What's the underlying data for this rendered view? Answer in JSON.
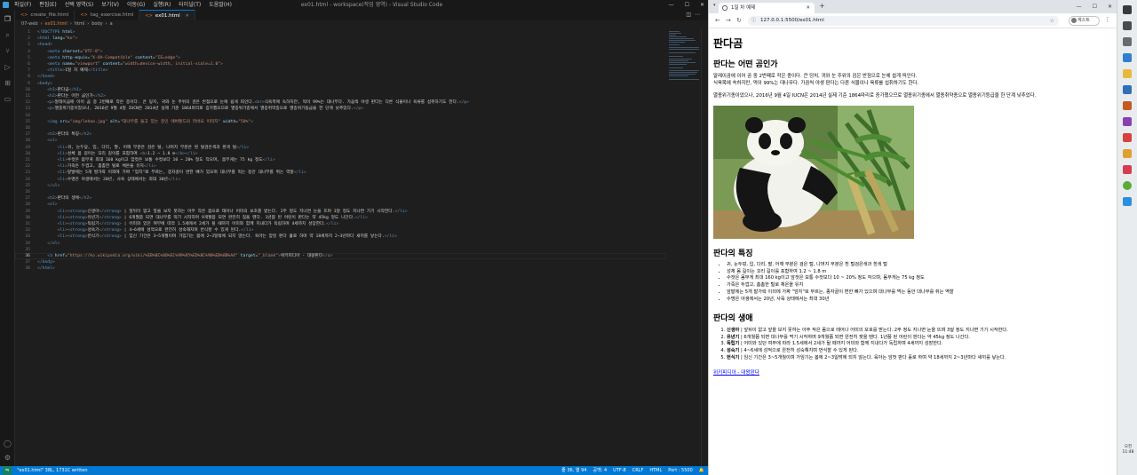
{
  "vscode": {
    "menu": [
      "파일(F)",
      "편집(E)",
      "선택 영역(S)",
      "보기(V)",
      "이동(G)",
      "실행(R)",
      "터미널(T)",
      "도움말(H)"
    ],
    "window_title": "ex01.html - workspace(작업 영역) - Visual Studio Code",
    "tabs": [
      {
        "label": "create_file.html",
        "active": false
      },
      {
        "label": "tag_exercise.html",
        "active": false
      },
      {
        "label": "ex01.html",
        "active": true
      }
    ],
    "breadcrumb": [
      "07-web",
      "ex01.html",
      "html",
      "body",
      "a"
    ],
    "code_lines": [
      {
        "n": "1",
        "html": "<span class='t-br'>&lt;</span><span class='t-doc'>!DOCTYPE</span> <span class='t-attr'>html</span><span class='t-br'>&gt;</span>"
      },
      {
        "n": "2",
        "html": "<span class='t-br'>&lt;</span><span class='t-tag'>html</span> <span class='t-attr'>lang</span>=<span class='t-str'>\"ko\"</span><span class='t-br'>&gt;</span>"
      },
      {
        "n": "3",
        "html": "<span class='t-br'>&lt;</span><span class='t-tag'>head</span><span class='t-br'>&gt;</span>"
      },
      {
        "n": "4",
        "html": "    <span class='t-br'>&lt;</span><span class='t-tag'>meta</span> <span class='t-attr'>charset</span>=<span class='t-str'>\"UTF-8\"</span><span class='t-br'>&gt;</span>"
      },
      {
        "n": "5",
        "html": "    <span class='t-br'>&lt;</span><span class='t-tag'>meta</span> <span class='t-attr'>http-equiv</span>=<span class='t-str'>\"X-UA-Compatible\"</span> <span class='t-attr'>content</span>=<span class='t-str'>\"IE=edge\"</span><span class='t-br'>&gt;</span>"
      },
      {
        "n": "6",
        "html": "    <span class='t-br'>&lt;</span><span class='t-tag'>meta</span> <span class='t-attr'>name</span>=<span class='t-str'>\"viewport\"</span> <span class='t-attr'>content</span>=<span class='t-str'>\"width=device-width, initial-scale=1.0\"</span><span class='t-br'>&gt;</span>"
      },
      {
        "n": "7",
        "html": "    <span class='t-br'>&lt;</span><span class='t-tag'>title</span><span class='t-br'>&gt;</span>1일 차 예제<span class='t-br'>&lt;/</span><span class='t-tag'>title</span><span class='t-br'>&gt;</span>"
      },
      {
        "n": "8",
        "html": "<span class='t-br'>&lt;/</span><span class='t-tag'>head</span><span class='t-br'>&gt;</span>"
      },
      {
        "n": "9",
        "html": "<span class='t-br'>&lt;</span><span class='t-tag'>body</span><span class='t-br'>&gt;</span>"
      },
      {
        "n": "10",
        "html": "    <span class='t-br'>&lt;</span><span class='t-tag'>h1</span><span class='t-br'>&gt;</span>판다곰<span class='t-br'>&lt;/</span><span class='t-tag'>h1</span><span class='t-br'>&gt;</span>"
      },
      {
        "n": "11",
        "html": "    <span class='t-br'>&lt;</span><span class='t-tag'>h2</span><span class='t-br'>&gt;</span>판다는 어떤 곰인가<span class='t-br'>&lt;/</span><span class='t-tag'>h2</span><span class='t-br'>&gt;</span>"
      },
      {
        "n": "12",
        "html": "    <span class='t-br'>&lt;</span><span class='t-tag'>p</span><span class='t-br'>&gt;</span>말레이곰에 이어 곰 중 2번째로 작은 종이다. 큰 덩치, 귀와 눈 주위의 검은 반점으로 눈에 쉽게 띄인다.<span class='t-br'>&lt;</span><span class='t-tag'>br</span><span class='t-br'>&gt;</span>식육목에 속하지만, 먹이 99%는 대나무다. 가끔씩 야생 판다는 다른 식물이나 육류를 섭취하기도 한다.<span class='t-br'>&lt;/</span><span class='t-tag'>p</span><span class='t-br'>&gt;</span>"
      },
      {
        "n": "13",
        "html": "    <span class='t-br'>&lt;</span><span class='t-tag'>p</span><span class='t-br'>&gt;</span>멸종위기종이었으나, 2016년 9월 4일 IUCN은 2014년 실제 기준 1864마리로 증가했으므로 멸종위기종에서 멸종취약종으로 멸종위기등급을 한 단계 낮추었다.<span class='t-br'>&lt;/</span><span class='t-tag'>p</span><span class='t-br'>&gt;</span>"
      },
      {
        "n": "14",
        "html": ""
      },
      {
        "n": "15",
        "html": "    <span class='t-br'>&lt;</span><span class='t-tag'>img</span> <span class='t-attr'>src</span>=<span class='t-str'>\"img/lehao.jpg\"</span> <span class='t-attr'>alt</span>=<span class='t-str'>\"대나무를 들고 있는 중인 에버랜드의 러바오 이미지\"</span> <span class='t-attr'>width</span>=<span class='t-str'>\"50%\"</span><span class='t-br'>&gt;</span>"
      },
      {
        "n": "16",
        "html": ""
      },
      {
        "n": "17",
        "html": "    <span class='t-br'>&lt;</span><span class='t-tag'>h2</span><span class='t-br'>&gt;</span>판다의 특징<span class='t-br'>&lt;/</span><span class='t-tag'>h2</span><span class='t-br'>&gt;</span>"
      },
      {
        "n": "18",
        "html": "    <span class='t-br'>&lt;</span><span class='t-tag'>ul</span><span class='t-br'>&gt;</span>"
      },
      {
        "n": "19",
        "html": "        <span class='t-br'>&lt;</span><span class='t-tag'>li</span><span class='t-br'>&gt;</span>귀, 눈두덩, 입, 다리, 팔, 어깨 부분은 검은 털, 나머지 부분은 흰 털검은색과 흰색 털<span class='t-br'>&lt;/</span><span class='t-tag'>li</span><span class='t-br'>&gt;</span>"
      },
      {
        "n": "20",
        "html": "        <span class='t-br'>&lt;</span><span class='t-tag'>li</span><span class='t-br'>&gt;</span>성체 몸 길이는 꼬리 길이를 포함하여 <span class='t-br'>&lt;</span><span class='t-tag'>b</span><span class='t-br'>&gt;</span>1.2 ~ 1.8 m<span class='t-br'>&lt;/</span><span class='t-tag'>b</span><span class='t-br'>&gt;</span><span class='t-br'>&lt;/</span><span class='t-tag'>li</span><span class='t-br'>&gt;</span>"
      },
      {
        "n": "21",
        "html": "        <span class='t-br'>&lt;</span><span class='t-tag'>li</span><span class='t-br'>&gt;</span>수컷은 몸무게 최대 160 kg이고 암컷은 보통 수컷보다 10 ~ 20% 정도 작으며, 몸무게는 75 kg 정도<span class='t-br'>&lt;/</span><span class='t-tag'>li</span><span class='t-br'>&gt;</span>"
      },
      {
        "n": "22",
        "html": "        <span class='t-br'>&lt;</span><span class='t-tag'>li</span><span class='t-br'>&gt;</span>가죽은 두껍고, 촘촘한 털로 체온을 유지<span class='t-br'>&lt;/</span><span class='t-tag'>li</span><span class='t-br'>&gt;</span>"
      },
      {
        "n": "23",
        "html": "        <span class='t-br'>&lt;</span><span class='t-tag'>li</span><span class='t-br'>&gt;</span>앞발에는 5개 발가락 이외에 가짜 \"엄지\"로 부르는, 종자골이 변한 뼈가 있으며 대나무를 먹는 동안 대나무를 쥐는 역할<span class='t-br'>&lt;/</span><span class='t-tag'>li</span><span class='t-br'>&gt;</span>"
      },
      {
        "n": "24",
        "html": "        <span class='t-br'>&lt;</span><span class='t-tag'>li</span><span class='t-br'>&gt;</span>수명은 야생에서는 20년, 사육 상태에서는 최대 30년<span class='t-br'>&lt;/</span><span class='t-tag'>li</span><span class='t-br'>&gt;</span>"
      },
      {
        "n": "25",
        "html": "    <span class='t-br'>&lt;/</span><span class='t-tag'>ul</span><span class='t-br'>&gt;</span>"
      },
      {
        "n": "26",
        "html": ""
      },
      {
        "n": "27",
        "html": "    <span class='t-br'>&lt;</span><span class='t-tag'>h2</span><span class='t-br'>&gt;</span>판다의 생애<span class='t-br'>&lt;/</span><span class='t-tag'>h2</span><span class='t-br'>&gt;</span>"
      },
      {
        "n": "28",
        "html": "    <span class='t-br'>&lt;</span><span class='t-tag'>ol</span><span class='t-br'>&gt;</span>"
      },
      {
        "n": "29",
        "html": "        <span class='t-br'>&lt;</span><span class='t-tag'>li</span><span class='t-br'>&gt;&lt;</span><span class='t-tag'>strong</span><span class='t-br'>&gt;</span>신생아<span class='t-br'>&lt;/</span><span class='t-tag'>strong</span><span class='t-br'>&gt;</span> | 앞뒤이 없고 앞을 보지 못하는 아주 작은 몸으로 태어나 어미의 보호를 받는다. 2주 정도 지나면 눈을 뜨며 3달 정도 지나면 기기 시작한다.<span class='t-br'>&lt;/</span><span class='t-tag'>li</span><span class='t-br'>&gt;</span>"
      },
      {
        "n": "30",
        "html": "        <span class='t-br'>&lt;</span><span class='t-tag'>li</span><span class='t-br'>&gt;&lt;</span><span class='t-tag'>strong</span><span class='t-br'>&gt;</span>유년기<span class='t-br'>&lt;/</span><span class='t-tag'>strong</span><span class='t-br'>&gt;</span> | 6개월쯤 되면 대나무를 먹기 시작하며 9개월쯤 되면 완전히 젖을 뗀다. 1년쯤 된 어린이 판다는 약 45kg 정도 나간다.<span class='t-br'>&lt;/</span><span class='t-tag'>li</span><span class='t-br'>&gt;</span>"
      },
      {
        "n": "31",
        "html": "        <span class='t-br'>&lt;</span><span class='t-tag'>li</span><span class='t-br'>&gt;&lt;</span><span class='t-tag'>strong</span><span class='t-br'>&gt;</span>독립기<span class='t-br'>&lt;/</span><span class='t-tag'>strong</span><span class='t-br'>&gt;</span> | 어미와 있던 여부에 따라 1.5세에서 2세가 될 때까지 어미와 함께 지내다가 독립하며 4세까지 성장한다.<span class='t-br'>&lt;/</span><span class='t-tag'>li</span><span class='t-br'>&gt;</span>"
      },
      {
        "n": "32",
        "html": "        <span class='t-br'>&lt;</span><span class='t-tag'>li</span><span class='t-br'>&gt;&lt;</span><span class='t-tag'>strong</span><span class='t-br'>&gt;</span>성숙기<span class='t-br'>&lt;/</span><span class='t-tag'>strong</span><span class='t-br'>&gt;</span> | 4~6세에 성적으로 완전히 성숙해지며 번식할 수 있게 된다.<span class='t-br'>&lt;/</span><span class='t-tag'>li</span><span class='t-br'>&gt;</span>"
      },
      {
        "n": "33",
        "html": "        <span class='t-br'>&lt;</span><span class='t-tag'>li</span><span class='t-br'>&gt;&lt;</span><span class='t-tag'>strong</span><span class='t-br'>&gt;</span>번식기<span class='t-br'>&lt;/</span><span class='t-tag'>strong</span><span class='t-br'>&gt;</span> | 임신 기간은 3~5개월이며 가임기는 봄에 2~3일밖에 되지 않는다. 육아는 암컷 판다 홀로 하며 약 18세까지 2~3년마다 새끼를 낳는다.<span class='t-br'>&lt;/</span><span class='t-tag'>li</span><span class='t-br'>&gt;</span>"
      },
      {
        "n": "34",
        "html": "    <span class='t-br'>&lt;/</span><span class='t-tag'>ol</span><span class='t-br'>&gt;</span>"
      },
      {
        "n": "35",
        "html": ""
      },
      {
        "n": "36",
        "html": "    <span class='t-br'>&lt;</span><span class='t-tag'>a</span> <span class='t-attr'>href</span>=<span class='t-str'>\"https://ko.wikipedia.org/wiki/%EB%8C%80%EC%99%95%ED%8C%90%EB%8B%A4\"</span> <span class='t-attr'>target</span>=<span class='t-str'>\"_blank\"</span><span class='t-br'>&gt;</span>위키피디아 - 대왕판다<span class='t-br'>&lt;/</span><span class='t-tag'>a</span><span class='t-br'>&gt;</span>"
      },
      {
        "n": "37",
        "html": "<span class='t-br'>&lt;/</span><span class='t-tag'>body</span><span class='t-br'>&gt;</span>"
      },
      {
        "n": "38",
        "html": "<span class='t-br'>&lt;/</span><span class='t-tag'>html</span><span class='t-br'>&gt;</span>"
      }
    ],
    "status_left": [
      "\"ex01.html\" 38L, 1731C written"
    ],
    "status_right": [
      "줄 36, 열 94",
      "공백: 4",
      "UTF-8",
      "CRLF",
      "HTML",
      "Port : 5500"
    ]
  },
  "browser": {
    "tab_title": "1일 차 예제",
    "url": "127.0.0.1:5500/ex01.html",
    "guest_label": "게스트",
    "page": {
      "h1": "판다곰",
      "h2_about": "판다는 어떤 곰인가",
      "p1_line1": "말레이곰에 이어 곰 중 2번째로 작은 종이다. 큰 덩치, 귀와 눈 주위의 검은 반점으로 눈에 쉽게 띄인다.",
      "p1_line2": "식육목에 속하지만, 먹이 99%는 대나무다. 가끔씩 야생 판다는 다른 식물이나 육류를 섭취하기도 한다.",
      "p2": "멸종위기종이었으나, 2016년 9월 4일 IUCN은 2014년 실제 기준 1864마리로 증가했으므로 멸종위기종에서 멸종취약종으로 멸종위기등급을 한 단계 낮추었다.",
      "h2_features": "판다의 특징",
      "features": [
        "귀, 눈두덩, 입, 다리, 팔, 어깨 부분은 검은 털, 나머지 부분은 흰 털검은색과 흰색 털",
        "성체 몸 길이는 꼬리 길이를 포함하여 1.2 ~ 1.8 m",
        "수컷은 몸무게 최대 160 kg이고 암컷은 보통 수컷보다 10 ~ 20% 정도 작으며, 몸무게는 75 kg 정도",
        "가죽은 두껍고, 촘촘한 털로 체온을 유지",
        "앞발에는 5개 발가락 이외에 가짜 \"엄지\"로 부르는, 종자골이 변한 뼈가 있으며 대나무를 먹는 동안 대나무를 쥐는 역할",
        "수명은 야생에서는 20년, 사육 상태에서는 최대 30년"
      ],
      "h2_life": "판다의 생애",
      "life": [
        {
          "stage": "신생아",
          "text": " | 앞뒤이 없고 앞을 보지 못하는 아주 작은 몸으로 태어나 어미의 보호를 받는다. 2주 정도 지나면 눈을 뜨며 3달 정도 지나면 기기 시작한다."
        },
        {
          "stage": "유년기",
          "text": " | 6개월쯤 되면 대나무를 먹기 시작하며 9개월쯤 되면 완전히 젖을 뗀다. 1년쯤 된 어린이 판다는 약 45kg 정도 나간다."
        },
        {
          "stage": "독립기",
          "text": " | 어미와 있던 여부에 따라 1.5세에서 2세가 될 때까지 어미와 함께 지내다가 독립하며 4세까지 성장한다."
        },
        {
          "stage": "성숙기",
          "text": " | 4~6세에 성적으로 완전히 성숙해지며 번식할 수 있게 된다."
        },
        {
          "stage": "번식기",
          "text": " | 임신 기간은 3~5개월이며 가임기는 봄에 2~3일밖에 되지 않는다. 육아는 암컷 판다 홀로 하며 약 18세까지 2~3년마다 새끼를 낳는다."
        }
      ],
      "link": "위키피디아 - 대왕판다"
    }
  },
  "taskbar": {
    "time": "오전 11:48"
  }
}
